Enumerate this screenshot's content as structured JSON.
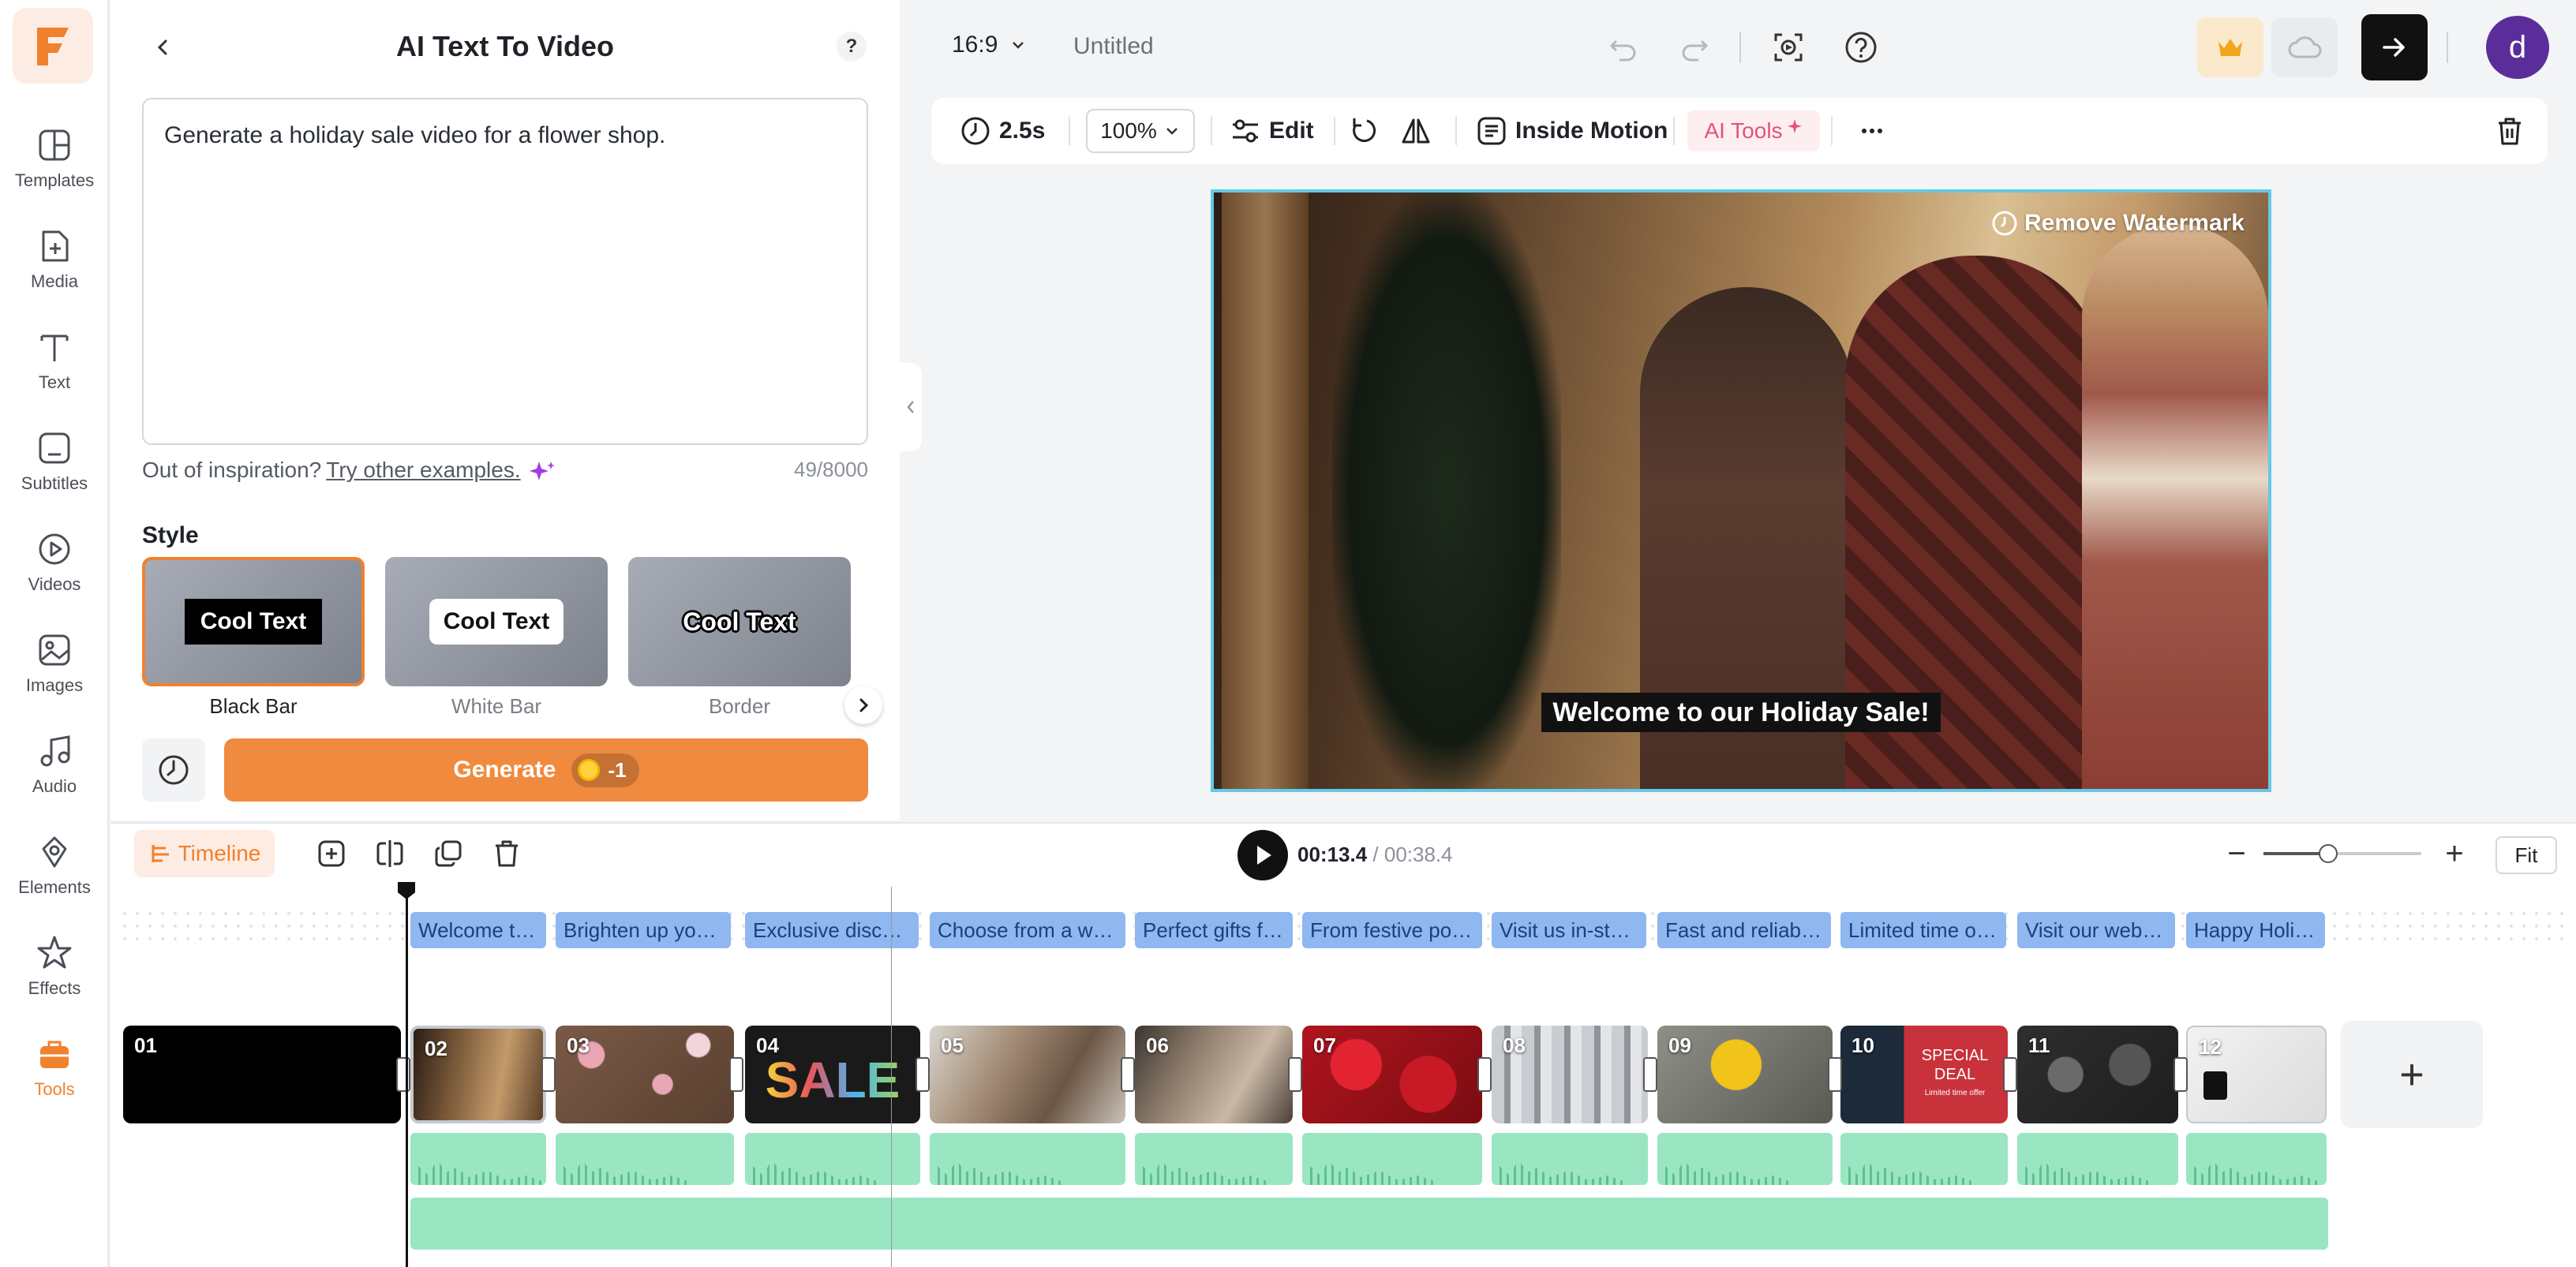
{
  "rail": {
    "items": [
      {
        "label": "Templates",
        "icon": "templates-icon"
      },
      {
        "label": "Media",
        "icon": "media-icon"
      },
      {
        "label": "Text",
        "icon": "text-icon"
      },
      {
        "label": "Subtitles",
        "icon": "subtitles-icon"
      },
      {
        "label": "Videos",
        "icon": "videos-icon"
      },
      {
        "label": "Images",
        "icon": "images-icon"
      },
      {
        "label": "Audio",
        "icon": "audio-icon"
      },
      {
        "label": "Elements",
        "icon": "elements-icon"
      },
      {
        "label": "Effects",
        "icon": "effects-icon"
      },
      {
        "label": "Tools",
        "icon": "tools-icon",
        "active": true
      }
    ]
  },
  "panel": {
    "title": "AI Text To Video",
    "help": "?",
    "prompt": "Generate a holiday sale video for a flower shop.",
    "inspiration_prefix": "Out of inspiration?",
    "inspiration_link": "Try other examples.",
    "char_count": "49/8000",
    "style_label": "Style",
    "styles": [
      {
        "sample": "Cool Text",
        "name": "Black Bar",
        "selected": true
      },
      {
        "sample": "Cool Text",
        "name": "White Bar"
      },
      {
        "sample": "Cool Text",
        "name": "Border"
      }
    ],
    "generate_label": "Generate",
    "generate_cost": "-1"
  },
  "topbar": {
    "ratio": "16:9",
    "doc_title": "Untitled",
    "avatar_letter": "d"
  },
  "edit_toolbar": {
    "duration": "2.5s",
    "zoom": "100%",
    "edit": "Edit",
    "inside_motion": "Inside Motion",
    "ai_tools": "AI Tools"
  },
  "canvas": {
    "watermark": "Remove Watermark",
    "subtitle": "Welcome to our Holiday Sale!"
  },
  "timeline": {
    "label": "Timeline",
    "current_time": "00:13.4",
    "total_time": " / 00:38.4",
    "fit": "Fit",
    "subtitles": [
      "Welcome to...",
      "Brighten up your ...",
      "Exclusive discou...",
      "Choose from a wid...",
      "Perfect gifts fo...",
      "From festive poin...",
      "Visit us in-stor...",
      "Fast and reliable...",
      "Limited time off...",
      "Visit our websi...",
      "Happy Holid..."
    ],
    "scenes": [
      "01",
      "02",
      "03",
      "04",
      "05",
      "06",
      "07",
      "08",
      "09",
      "10",
      "11",
      "12"
    ],
    "scene_texts": {
      "scene04": "SALE",
      "scene10_line1": "SPECIAL",
      "scene10_line2": "DEAL",
      "scene10_line3": "Limited time offer"
    }
  },
  "colors": {
    "accent": "#f0812f",
    "subtitle_chip": "#8fb7f0",
    "audio": "#9ae6c2",
    "canvas_border": "#64c9e8"
  }
}
